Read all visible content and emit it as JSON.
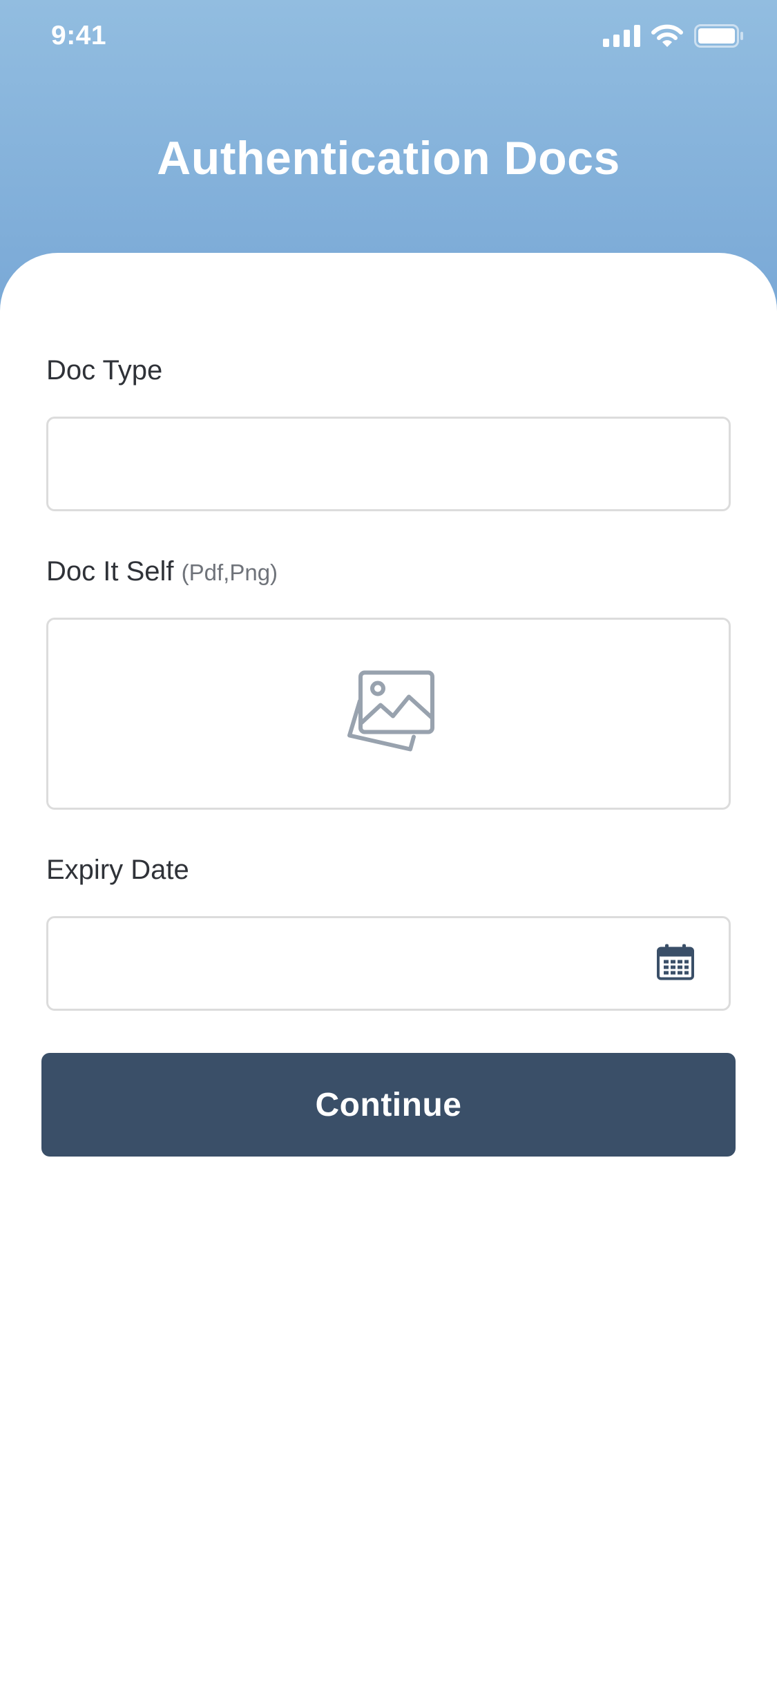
{
  "status_bar": {
    "time": "9:41",
    "icons": [
      "signal-icon",
      "wifi-icon",
      "battery-icon"
    ]
  },
  "header": {
    "title": "Authentication Docs",
    "gradient_top": "#92bde0",
    "gradient_bottom": "#79a8d6"
  },
  "form": {
    "doc_type": {
      "label": "Doc Type",
      "value": ""
    },
    "doc_itself": {
      "label": "Doc It Self",
      "hint": "(Pdf,Png)",
      "icon": "image-upload-icon"
    },
    "expiry_date": {
      "label": "Expiry Date",
      "value": "",
      "icon": "calendar-icon"
    }
  },
  "actions": {
    "continue_label": "Continue",
    "button_color": "#3a4f68"
  }
}
